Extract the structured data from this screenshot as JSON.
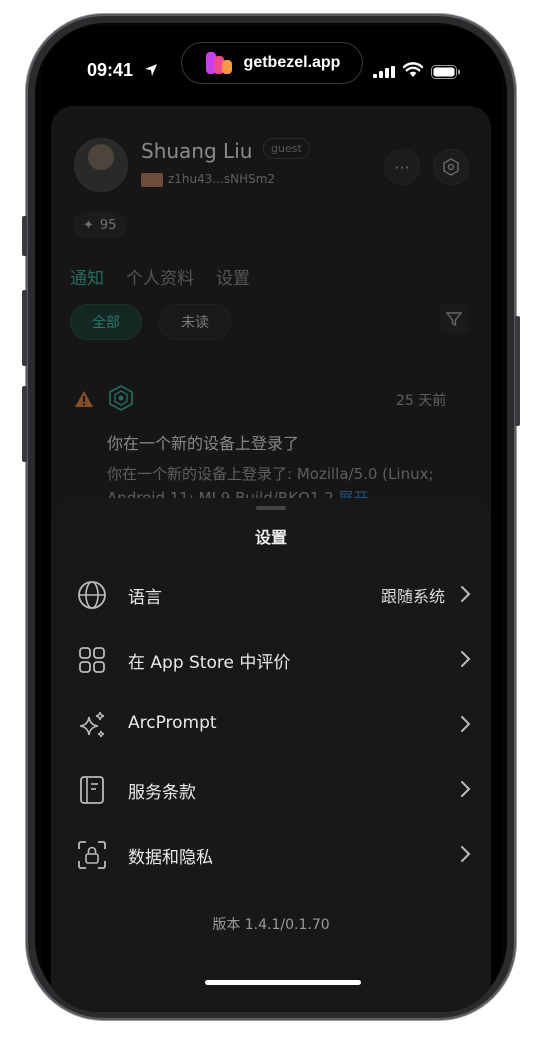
{
  "status_bar": {
    "time": "09:41",
    "banner_text": "getbezel.app"
  },
  "profile": {
    "name": "Shuang Liu",
    "badge": "guest",
    "wallet": "z1hu43...sNHSm2",
    "points": "95"
  },
  "tabs": [
    {
      "label": "通知",
      "active": true
    },
    {
      "label": "个人资料",
      "active": false
    },
    {
      "label": "设置",
      "active": false
    }
  ],
  "filters": {
    "all": "全部",
    "unread": "未读"
  },
  "notification": {
    "date": "25 天前",
    "title": "你在一个新的设备上登录了",
    "body": "你在一个新的设备上登录了: Mozilla/5.0 (Linux; Android 11; MI 9 Build/RKQ1.2",
    "expand": "展开"
  },
  "settings_sheet": {
    "title": "设置",
    "items": [
      {
        "icon": "globe-icon",
        "label": "语言",
        "value": "跟随系统"
      },
      {
        "icon": "apps-grid-icon",
        "label": "在 App Store 中评价",
        "value": ""
      },
      {
        "icon": "sparkles-icon",
        "label": "ArcPrompt",
        "value": ""
      },
      {
        "icon": "book-icon",
        "label": "服务条款",
        "value": ""
      },
      {
        "icon": "privacy-lock-icon",
        "label": "数据和隐私",
        "value": ""
      }
    ],
    "version": "版本 1.4.1/0.1.70"
  },
  "colors": {
    "accent": "#2fb39a",
    "link": "#2f7fd0",
    "warning": "#e07a2e"
  }
}
